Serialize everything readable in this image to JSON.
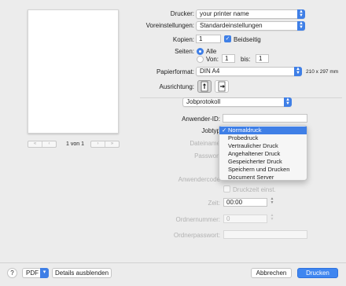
{
  "preview": {
    "page_indicator": "1 von 1",
    "nav_left": [
      "«",
      "‹"
    ],
    "nav_right": [
      "›",
      "»"
    ]
  },
  "printer": {
    "label": "Drucker:",
    "value": "your printer name"
  },
  "presets": {
    "label": "Voreinstellungen:",
    "value": "Standardeinstellungen"
  },
  "copies": {
    "label": "Kopien:",
    "value": "1",
    "duplex_label": "Beidseitig",
    "duplex_checked": true
  },
  "pages": {
    "label": "Seiten:",
    "all_label": "Alle",
    "from_label": "Von:",
    "from_value": "1",
    "to_label": "bis:",
    "to_value": "1"
  },
  "paper": {
    "label": "Papierformat:",
    "value": "DIN A4",
    "size_text": "210 x 297 mm"
  },
  "orientation": {
    "label": "Ausrichtung:"
  },
  "panel": {
    "value": "Jobprotokoll"
  },
  "job": {
    "user_id_label": "Anwender-ID:",
    "user_id_value": "",
    "job_type_label": "Jobtyp",
    "file_name_label": "Dateiname",
    "password_label": "Passwort",
    "user_code_label": "Anwendercode",
    "print_time_label": "Druckzeit einst.",
    "time_label": "Zeit:",
    "time_value": "00:00",
    "folder_number_label": "Ordnernummer:",
    "folder_number_value": "0",
    "folder_password_label": "Ordnerpasswort:"
  },
  "job_type_menu": {
    "items": [
      "Normaldruck",
      "Probedruck",
      "Vertraulicher Druck",
      "Angehaltener Druck",
      "Gespeicherter Druck",
      "Speichern und Drucken",
      "Document Server"
    ],
    "selected": "Normaldruck",
    "checkmark": "✓"
  },
  "footer": {
    "help": "?",
    "pdf_label": "PDF",
    "hide_details_label": "Details ausblenden",
    "cancel_label": "Abbrechen",
    "print_label": "Drucken"
  },
  "colors": {
    "accent": "#3f7fe6",
    "primary_button": "#3f86f0"
  }
}
